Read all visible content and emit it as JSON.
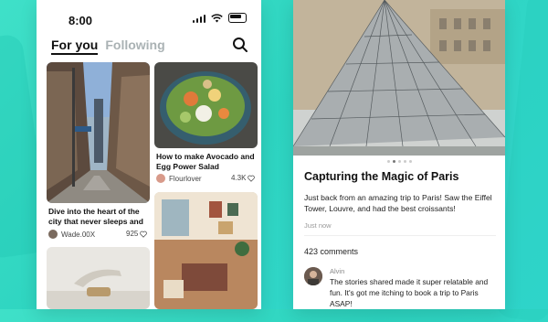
{
  "status": {
    "time": "8:00"
  },
  "feed": {
    "tabs": [
      {
        "label": "For you",
        "active": true
      },
      {
        "label": "Following",
        "active": false
      }
    ],
    "cards": [
      {
        "title": "Dive into the heart of the city that never sleeps and",
        "author": "Wade.00X",
        "likes": "925"
      },
      {
        "title": "How to make Avocado and Egg Power Salad",
        "author": "Flourlover",
        "likes": "4.3K"
      }
    ]
  },
  "post": {
    "title": "Capturing the Magic of Paris",
    "body": "Just back from an amazing trip to Paris! Saw the Eiffel Tower, Louvre, and had the best croissants!",
    "time": "Just now",
    "comments_count": "423 comments",
    "comment": {
      "author": "Alvin",
      "text": "The stories shared made it super relatable and fun. It's got me itching to book a trip to Paris ASAP!"
    }
  },
  "colors": {
    "background": "#2dd4c0",
    "text": "#111111",
    "muted": "#aab2b4"
  },
  "icons": [
    "search-icon",
    "wifi-icon",
    "signal-icon",
    "battery-icon",
    "heart-icon"
  ]
}
